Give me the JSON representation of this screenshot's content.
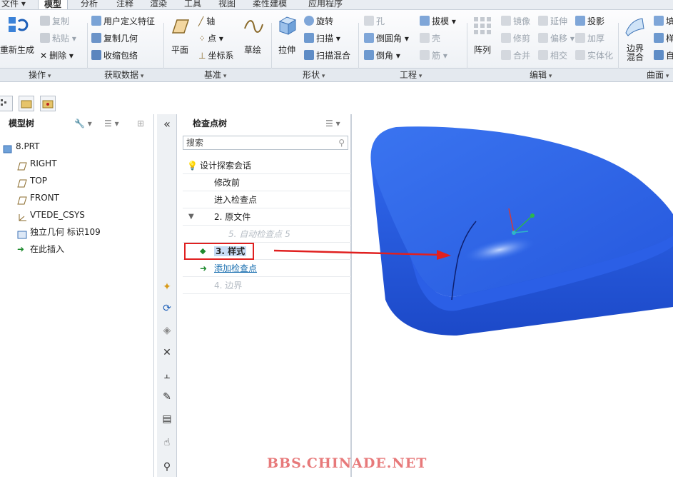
{
  "tabs": [
    "文件",
    "模型",
    "分析",
    "注释",
    "渲染",
    "工具",
    "视图",
    "柔性建模",
    "应用程序"
  ],
  "ribbon": {
    "operation": {
      "regen": "重新生成",
      "copy": "复制",
      "paste": "粘贴",
      "delete": "删除"
    },
    "getdata": {
      "udf": "用户定义特征",
      "copygeom": "复制几何",
      "shrinkwrap": "收缩包络"
    },
    "datum": {
      "plane": "平面",
      "axis": "轴",
      "point": "点",
      "csys": "坐标系",
      "sketch": "草绘"
    },
    "shapes": {
      "extrude": "拉伸",
      "revolve": "旋转",
      "sweep": "扫描",
      "sweepblend": "扫描混合"
    },
    "engineering": {
      "hole": "孔",
      "round": "倒圆角",
      "chamfer": "倒角",
      "draft": "拔模",
      "shell": "壳",
      "rib": "筋"
    },
    "editing": {
      "pattern": "阵列",
      "mirror": "镜像",
      "trim": "修剪",
      "merge": "合并",
      "extend": "延伸",
      "offset": "偏移",
      "intersect": "相交",
      "project": "投影",
      "thicken": "加厚",
      "solidify": "实体化"
    },
    "surfaces": {
      "boundary": "边界混合",
      "fill": "填",
      "style": "样",
      "freestyle": "自"
    }
  },
  "groups": [
    "操作",
    "获取数据",
    "基准",
    "形状",
    "工程",
    "编辑",
    "曲面"
  ],
  "model_tree": {
    "title": "模型树",
    "items": [
      "8.PRT",
      "RIGHT",
      "TOP",
      "FRONT",
      "VTEDE_CSYS",
      "独立几何 标识109",
      "在此插入"
    ]
  },
  "checkpoint_tree": {
    "title": "检查点树",
    "search_placeholder": "搜索",
    "items": [
      {
        "label": "设计探索会话",
        "state": "normal"
      },
      {
        "label": "修改前",
        "state": "normal"
      },
      {
        "label": "进入检查点",
        "state": "normal"
      },
      {
        "label": "2. 原文件",
        "state": "expanded"
      },
      {
        "label": "5. 自动检查点 5",
        "state": "italic-grey"
      },
      {
        "label": "3. 样式",
        "state": "selected"
      },
      {
        "label": "添加检查点",
        "state": "link"
      },
      {
        "label": "4. 边界",
        "state": "grey"
      }
    ]
  },
  "colors": {
    "model_blue": "#2f67e9",
    "highlight_red": "#e02020"
  },
  "watermark": "BBS.CHINADE.NET"
}
